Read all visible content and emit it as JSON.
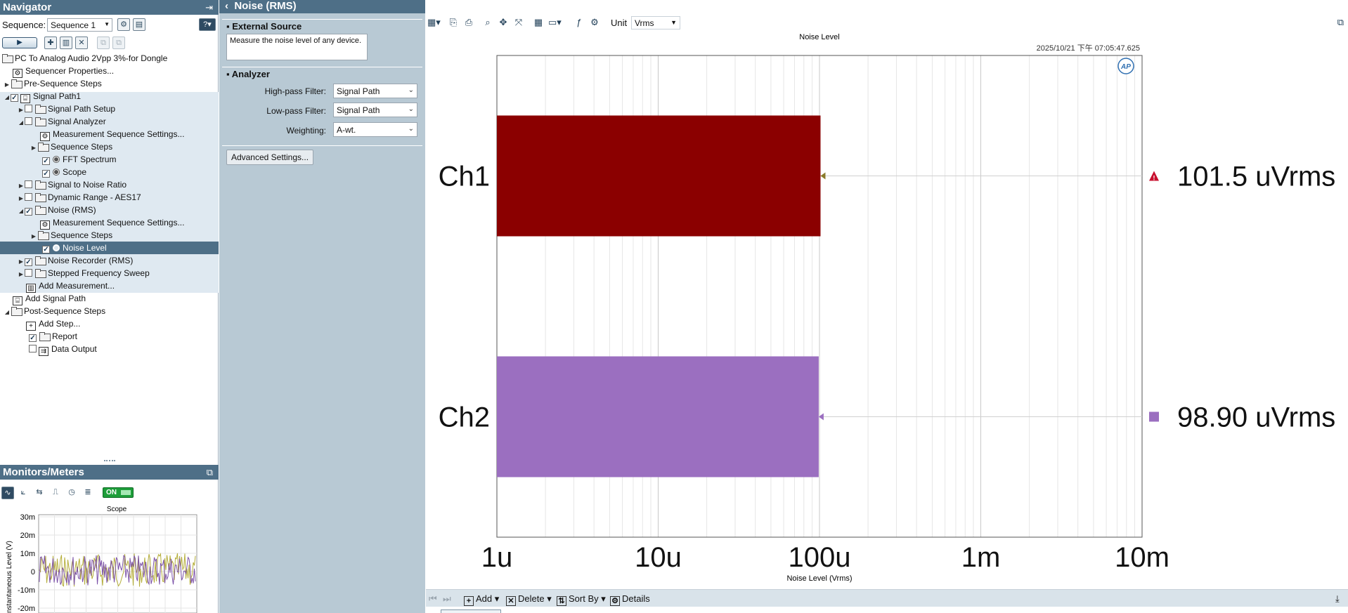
{
  "navigator": {
    "title": "Navigator",
    "sequence_label": "Sequence:",
    "sequence_value": "Sequence 1",
    "tree": {
      "project": "PC To Analog Audio 2Vpp 3%-for Dongle",
      "sequencer_properties": "Sequencer Properties...",
      "pre_sequence_steps": "Pre-Sequence Steps",
      "signal_path1": "Signal Path1",
      "signal_path_setup": "Signal Path Setup",
      "signal_analyzer": "Signal Analyzer",
      "measurement_sequence_settings_1": "Measurement Sequence Settings...",
      "sequence_steps_1": "Sequence Steps",
      "fft_spectrum": "FFT Spectrum",
      "scope": "Scope",
      "signal_to_noise_ratio": "Signal to Noise Ratio",
      "dynamic_range": "Dynamic Range - AES17",
      "noise_rms": "Noise (RMS)",
      "measurement_sequence_settings_2": "Measurement Sequence Settings...",
      "sequence_steps_2": "Sequence Steps",
      "noise_level": "Noise Level",
      "noise_recorder": "Noise Recorder (RMS)",
      "stepped_frequency_sweep": "Stepped Frequency Sweep",
      "add_measurement": "Add Measurement...",
      "add_signal_path": "Add Signal Path",
      "post_sequence_steps": "Post-Sequence Steps",
      "add_step": "Add Step...",
      "report": "Report",
      "data_output": "Data Output"
    }
  },
  "monitors": {
    "title": "Monitors/Meters",
    "on_label": "ON",
    "scope_title": "Scope",
    "y_axis_label": "Instantaneous Level (V)",
    "y_ticks": [
      "30m",
      "20m",
      "10m",
      "0",
      "-10m",
      "-20m"
    ]
  },
  "settings": {
    "title": "Noise (RMS)",
    "external_source_header": "External Source",
    "description": "Measure the noise level of any device.",
    "analyzer_header": "Analyzer",
    "high_pass_label": "High-pass Filter:",
    "high_pass_value": "Signal Path",
    "low_pass_label": "Low-pass Filter:",
    "low_pass_value": "Signal Path",
    "weighting_label": "Weighting:",
    "weighting_value": "A-wt.",
    "advanced_button": "Advanced Settings..."
  },
  "graph_toolbar": {
    "unit_label": "Unit",
    "unit_value": "Vrms"
  },
  "bottom_bar": {
    "add": "Add",
    "delete": "Delete",
    "sort_by": "Sort By",
    "details": "Details"
  },
  "colors": {
    "ch1": "#8b0000",
    "ch2": "#9b6fc0",
    "header": "#4e6f87"
  },
  "chart_data": {
    "type": "bar",
    "orientation": "horizontal",
    "title": "Noise Level",
    "timestamp": "2025/10/21 下午 07:05:47.625",
    "xlabel": "Noise Level (Vrms)",
    "x_scale": "log",
    "xlim": [
      "1u",
      "10m"
    ],
    "x_ticks": [
      "1u",
      "10u",
      "100u",
      "1m",
      "10m"
    ],
    "categories": [
      "Ch1",
      "Ch2"
    ],
    "values_vrms": [
      0.0001015,
      9.89e-05
    ],
    "value_labels": [
      "101.5 uVrms",
      "98.90 uVrms"
    ],
    "grid": true,
    "logo": "AP"
  }
}
